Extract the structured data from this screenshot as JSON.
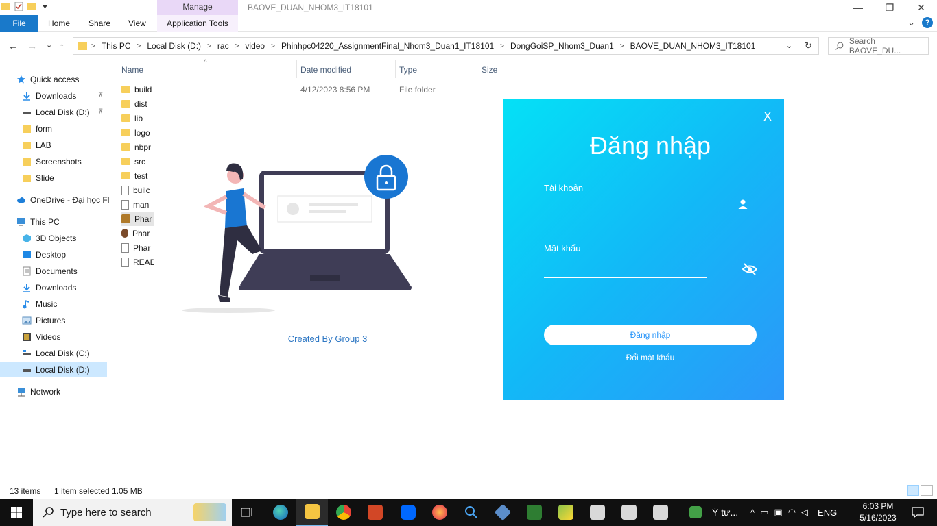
{
  "window": {
    "title": "BAOVE_DUAN_NHOM3_IT18101",
    "controls": {
      "minimize": "—",
      "maximize": "❐",
      "close": "✕"
    }
  },
  "ribbon": {
    "context_label": "Manage",
    "tabs": [
      "File",
      "Home",
      "Share",
      "View",
      "Application Tools"
    ],
    "help_glyph": "?",
    "collapse_glyph": "⌄"
  },
  "navigation": {
    "back_glyph": "←",
    "forward_glyph": "→",
    "recent_glyph": "⌄",
    "up_glyph": "↑"
  },
  "address_bar": {
    "crumbs": [
      "This PC",
      "Local Disk (D:)",
      "rac",
      "video",
      "Phinhpc04220_AssignmentFinal_Nhom3_Duan1_IT18101",
      "DongGoiSP_Nhom3_Duan1",
      "BAOVE_DUAN_NHOM3_IT18101"
    ],
    "separator_glyph": ">",
    "dropdown_glyph": "⌄",
    "refresh_glyph": "↻"
  },
  "search": {
    "placeholder": "Search BAOVE_DU...",
    "icon": "search-icon"
  },
  "nav_pane": {
    "items": [
      {
        "label": "Quick access",
        "icon": "star-icon",
        "pinned": false
      },
      {
        "label": "Downloads",
        "icon": "download-icon",
        "pinned": true
      },
      {
        "label": "Local Disk (D:)",
        "icon": "drive-icon",
        "pinned": true
      },
      {
        "label": "form",
        "icon": "folder-icon",
        "pinned": false
      },
      {
        "label": "LAB",
        "icon": "folder-icon",
        "pinned": false
      },
      {
        "label": "Screenshots",
        "icon": "folder-icon",
        "pinned": false
      },
      {
        "label": "Slide",
        "icon": "folder-icon",
        "pinned": false
      },
      {
        "label": "OneDrive - Đại học Fl",
        "icon": "cloud-icon",
        "pinned": false
      },
      {
        "label": "This PC",
        "icon": "computer-icon",
        "pinned": false
      },
      {
        "label": "3D Objects",
        "icon": "cube-icon",
        "pinned": false
      },
      {
        "label": "Desktop",
        "icon": "desktop-icon",
        "pinned": false
      },
      {
        "label": "Documents",
        "icon": "documents-icon",
        "pinned": false
      },
      {
        "label": "Downloads",
        "icon": "download-icon",
        "pinned": false
      },
      {
        "label": "Music",
        "icon": "music-icon",
        "pinned": false
      },
      {
        "label": "Pictures",
        "icon": "pictures-icon",
        "pinned": false
      },
      {
        "label": "Videos",
        "icon": "videos-icon",
        "pinned": false
      },
      {
        "label": "Local Disk (C:)",
        "icon": "drive-icon",
        "pinned": false
      },
      {
        "label": "Local Disk (D:)",
        "icon": "drive-icon",
        "pinned": false,
        "selected": true
      },
      {
        "label": "Network",
        "icon": "network-icon",
        "pinned": false
      }
    ],
    "pin_glyph": "📌"
  },
  "file_list": {
    "columns": [
      "Name",
      "Date modified",
      "Type",
      "Size"
    ],
    "sort_glyph": "^",
    "rows": [
      {
        "name": "build",
        "kind": "folder",
        "date": "4/12/2023 8:56 PM",
        "type": "File folder"
      },
      {
        "name": "dist",
        "kind": "folder"
      },
      {
        "name": "lib",
        "kind": "folder"
      },
      {
        "name": "logo",
        "kind": "folder"
      },
      {
        "name": "nbpr",
        "kind": "folder"
      },
      {
        "name": "src",
        "kind": "folder"
      },
      {
        "name": "test",
        "kind": "folder"
      },
      {
        "name": "builc",
        "kind": "file"
      },
      {
        "name": "man",
        "kind": "file"
      },
      {
        "name": "Phar",
        "kind": "file",
        "selected": true
      },
      {
        "name": "Phar",
        "kind": "file"
      },
      {
        "name": "Phar",
        "kind": "file"
      },
      {
        "name": "READ",
        "kind": "file"
      }
    ]
  },
  "app": {
    "created_by": "Created By Group 3",
    "login": {
      "close_label": "X",
      "title": "Đăng nhập",
      "username_label": "Tài khoản",
      "username_value": "",
      "password_label": "Mật khẩu",
      "password_value": "",
      "submit_label": "Đăng nhập",
      "change_password_label": "Đổi mật khẩu"
    },
    "colors": {
      "gradient_start": "#04e1f6",
      "gradient_end": "#2c97f9",
      "accent": "#2f78c4"
    }
  },
  "status_bar": {
    "item_count": "13 items",
    "selection": "1 item selected  1.05 MB"
  },
  "taskbar": {
    "search_placeholder": "Type here to search",
    "running_label": "Ý tư...",
    "language": "ENG",
    "time": "6:03 PM",
    "date": "5/16/2023",
    "tray_chevron": "^"
  }
}
